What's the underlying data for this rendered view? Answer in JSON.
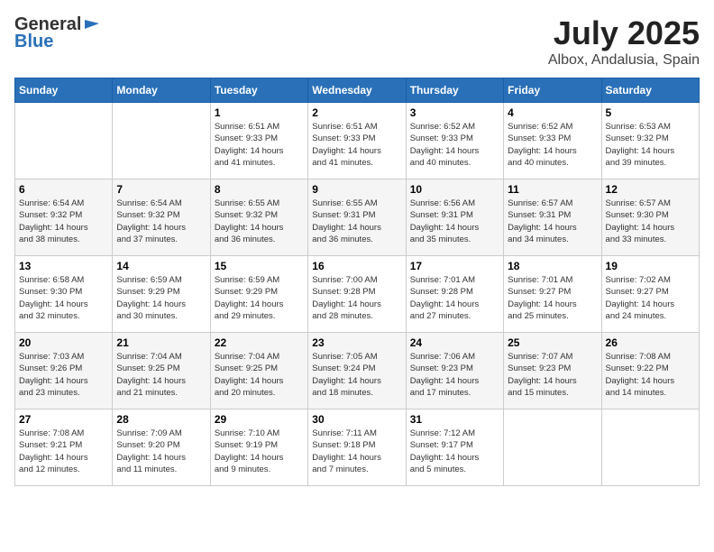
{
  "header": {
    "logo_general": "General",
    "logo_blue": "Blue",
    "title": "July 2025",
    "subtitle": "Albox, Andalusia, Spain"
  },
  "days_of_week": [
    "Sunday",
    "Monday",
    "Tuesday",
    "Wednesday",
    "Thursday",
    "Friday",
    "Saturday"
  ],
  "weeks": [
    [
      {
        "day": "",
        "info": ""
      },
      {
        "day": "",
        "info": ""
      },
      {
        "day": "1",
        "info": "Sunrise: 6:51 AM\nSunset: 9:33 PM\nDaylight: 14 hours\nand 41 minutes."
      },
      {
        "day": "2",
        "info": "Sunrise: 6:51 AM\nSunset: 9:33 PM\nDaylight: 14 hours\nand 41 minutes."
      },
      {
        "day": "3",
        "info": "Sunrise: 6:52 AM\nSunset: 9:33 PM\nDaylight: 14 hours\nand 40 minutes."
      },
      {
        "day": "4",
        "info": "Sunrise: 6:52 AM\nSunset: 9:33 PM\nDaylight: 14 hours\nand 40 minutes."
      },
      {
        "day": "5",
        "info": "Sunrise: 6:53 AM\nSunset: 9:32 PM\nDaylight: 14 hours\nand 39 minutes."
      }
    ],
    [
      {
        "day": "6",
        "info": "Sunrise: 6:54 AM\nSunset: 9:32 PM\nDaylight: 14 hours\nand 38 minutes."
      },
      {
        "day": "7",
        "info": "Sunrise: 6:54 AM\nSunset: 9:32 PM\nDaylight: 14 hours\nand 37 minutes."
      },
      {
        "day": "8",
        "info": "Sunrise: 6:55 AM\nSunset: 9:32 PM\nDaylight: 14 hours\nand 36 minutes."
      },
      {
        "day": "9",
        "info": "Sunrise: 6:55 AM\nSunset: 9:31 PM\nDaylight: 14 hours\nand 36 minutes."
      },
      {
        "day": "10",
        "info": "Sunrise: 6:56 AM\nSunset: 9:31 PM\nDaylight: 14 hours\nand 35 minutes."
      },
      {
        "day": "11",
        "info": "Sunrise: 6:57 AM\nSunset: 9:31 PM\nDaylight: 14 hours\nand 34 minutes."
      },
      {
        "day": "12",
        "info": "Sunrise: 6:57 AM\nSunset: 9:30 PM\nDaylight: 14 hours\nand 33 minutes."
      }
    ],
    [
      {
        "day": "13",
        "info": "Sunrise: 6:58 AM\nSunset: 9:30 PM\nDaylight: 14 hours\nand 32 minutes."
      },
      {
        "day": "14",
        "info": "Sunrise: 6:59 AM\nSunset: 9:29 PM\nDaylight: 14 hours\nand 30 minutes."
      },
      {
        "day": "15",
        "info": "Sunrise: 6:59 AM\nSunset: 9:29 PM\nDaylight: 14 hours\nand 29 minutes."
      },
      {
        "day": "16",
        "info": "Sunrise: 7:00 AM\nSunset: 9:28 PM\nDaylight: 14 hours\nand 28 minutes."
      },
      {
        "day": "17",
        "info": "Sunrise: 7:01 AM\nSunset: 9:28 PM\nDaylight: 14 hours\nand 27 minutes."
      },
      {
        "day": "18",
        "info": "Sunrise: 7:01 AM\nSunset: 9:27 PM\nDaylight: 14 hours\nand 25 minutes."
      },
      {
        "day": "19",
        "info": "Sunrise: 7:02 AM\nSunset: 9:27 PM\nDaylight: 14 hours\nand 24 minutes."
      }
    ],
    [
      {
        "day": "20",
        "info": "Sunrise: 7:03 AM\nSunset: 9:26 PM\nDaylight: 14 hours\nand 23 minutes."
      },
      {
        "day": "21",
        "info": "Sunrise: 7:04 AM\nSunset: 9:25 PM\nDaylight: 14 hours\nand 21 minutes."
      },
      {
        "day": "22",
        "info": "Sunrise: 7:04 AM\nSunset: 9:25 PM\nDaylight: 14 hours\nand 20 minutes."
      },
      {
        "day": "23",
        "info": "Sunrise: 7:05 AM\nSunset: 9:24 PM\nDaylight: 14 hours\nand 18 minutes."
      },
      {
        "day": "24",
        "info": "Sunrise: 7:06 AM\nSunset: 9:23 PM\nDaylight: 14 hours\nand 17 minutes."
      },
      {
        "day": "25",
        "info": "Sunrise: 7:07 AM\nSunset: 9:23 PM\nDaylight: 14 hours\nand 15 minutes."
      },
      {
        "day": "26",
        "info": "Sunrise: 7:08 AM\nSunset: 9:22 PM\nDaylight: 14 hours\nand 14 minutes."
      }
    ],
    [
      {
        "day": "27",
        "info": "Sunrise: 7:08 AM\nSunset: 9:21 PM\nDaylight: 14 hours\nand 12 minutes."
      },
      {
        "day": "28",
        "info": "Sunrise: 7:09 AM\nSunset: 9:20 PM\nDaylight: 14 hours\nand 11 minutes."
      },
      {
        "day": "29",
        "info": "Sunrise: 7:10 AM\nSunset: 9:19 PM\nDaylight: 14 hours\nand 9 minutes."
      },
      {
        "day": "30",
        "info": "Sunrise: 7:11 AM\nSunset: 9:18 PM\nDaylight: 14 hours\nand 7 minutes."
      },
      {
        "day": "31",
        "info": "Sunrise: 7:12 AM\nSunset: 9:17 PM\nDaylight: 14 hours\nand 5 minutes."
      },
      {
        "day": "",
        "info": ""
      },
      {
        "day": "",
        "info": ""
      }
    ]
  ]
}
